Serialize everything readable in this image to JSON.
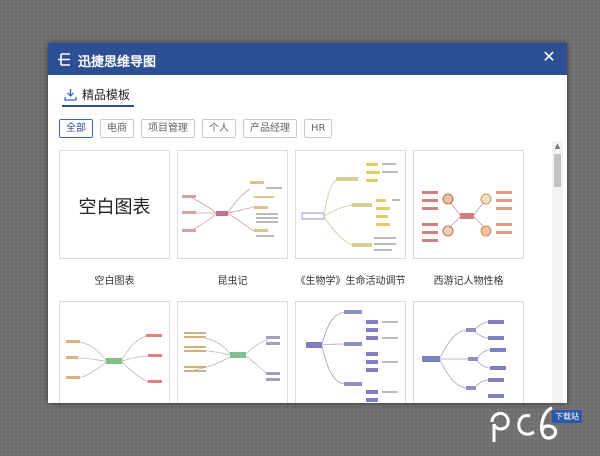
{
  "window": {
    "title": "迅捷思维导图"
  },
  "tab": {
    "label": "精品模板"
  },
  "filters": [
    "全部",
    "电商",
    "项目管理",
    "个人",
    "产品经理",
    "HR"
  ],
  "active_filter": 0,
  "templates": [
    {
      "name": "空白图表",
      "preview_text": "空白图表"
    },
    {
      "name": "昆虫记"
    },
    {
      "name": "《生物学》生命活动调节"
    },
    {
      "name": "西游记人物性格"
    },
    {
      "name": ""
    },
    {
      "name": ""
    },
    {
      "name": ""
    },
    {
      "name": ""
    }
  ],
  "watermark": {
    "site": "下载站"
  },
  "colors": {
    "titlebar": "#2d4f94",
    "accent": "#3a68c0"
  }
}
